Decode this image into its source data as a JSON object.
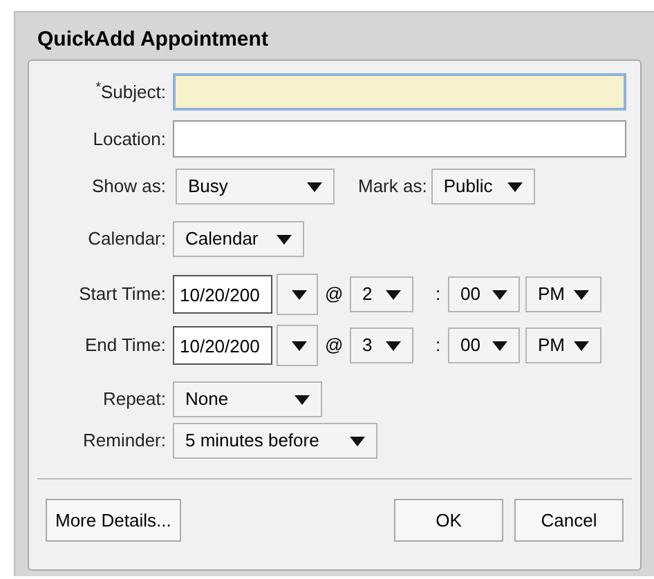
{
  "window": {
    "title": "QuickAdd Appointment"
  },
  "subject": {
    "label": "$^{*}$Subject:",
    "focused": true
  },
  "location": {
    "label": "Location:",
    "focused": false
  },
  "show_as": {
    "label": "Show as:",
    "value": "Busy"
  },
  "mark_as": {
    "label": "Mark as:",
    "value": "Public"
  },
  "calendar": {
    "label": "Calendar:",
    "value": "Calendar"
  },
  "start_time": {
    "label": "Start Time:",
    "date": "10/20/200",
    "at": "@",
    "hour": "2",
    "colon": ":",
    "minute": "00",
    "ampm": "PM"
  },
  "end_time": {
    "label": "End Time:",
    "date": "10/20/200",
    "at": "@",
    "hour": "3",
    "colon": ":",
    "minute": "00",
    "ampm": "PM"
  },
  "repeat": {
    "label": "Repeat:",
    "value": "None"
  },
  "reminder": {
    "label": "Reminder:",
    "value": "5 minutes before"
  },
  "buttons": {
    "more_details": "More Details...",
    "ok": "OK",
    "cancel": "Cancel"
  }
}
